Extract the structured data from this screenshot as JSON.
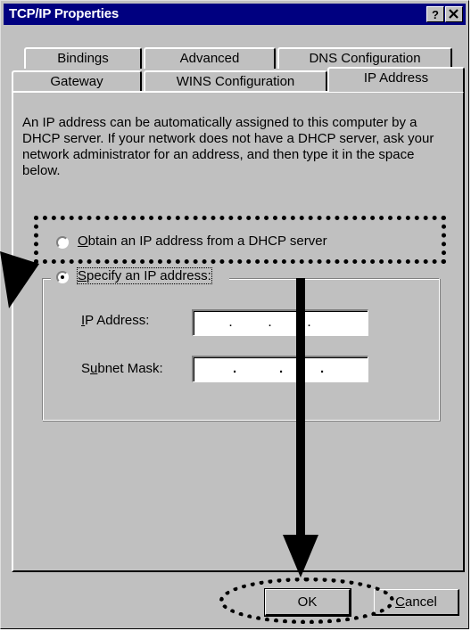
{
  "window": {
    "title": "TCP/IP Properties",
    "help_label": "?",
    "close_label": "x"
  },
  "tabs": {
    "row1": [
      "Bindings",
      "Advanced",
      "DNS Configuration"
    ],
    "row2": [
      "Gateway",
      "WINS Configuration",
      "IP Address"
    ],
    "active": "IP Address"
  },
  "description": "An IP address can be automatically assigned to this computer by a DHCP server. If your network does not have a DHCP server, ask your network administrator for an address, and then type it in the space below.",
  "options": {
    "obtain_prefix": "O",
    "obtain_rest": "btain an IP address from a DHCP server",
    "specify_prefix": "S",
    "specify_rest": "pecify an IP address:",
    "selected": "specify"
  },
  "fields": {
    "ip_prefix": "I",
    "ip_rest": "P Address:",
    "subnet_prefix": "S",
    "subnet_u": "u",
    "subnet_rest": "bnet Mask:"
  },
  "buttons": {
    "ok": "OK",
    "cancel_prefix": "C",
    "cancel_rest": "ancel"
  }
}
